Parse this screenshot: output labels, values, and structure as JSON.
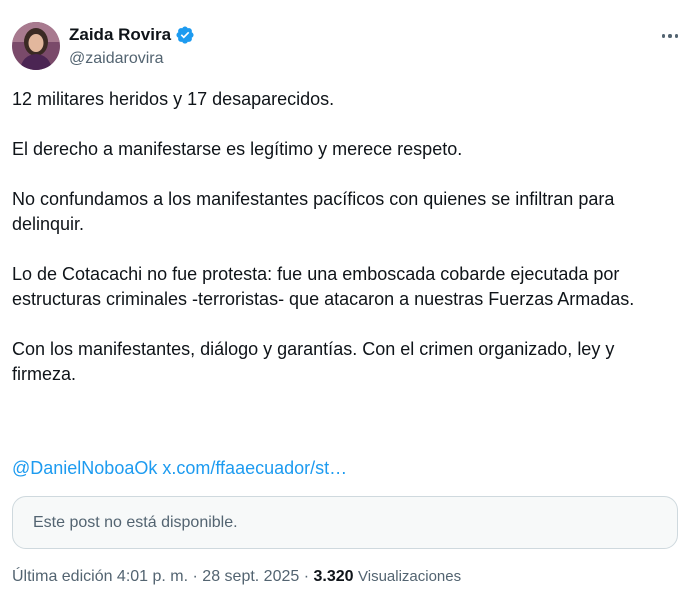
{
  "author": {
    "name": "Zaida Rovira",
    "handle": "@zaidarovira",
    "verified_icon": "verified-badge-icon",
    "verified_color": "#1d9bf0"
  },
  "tweet": {
    "paragraphs": [
      "12 militares heridos y 17 desaparecidos.",
      "El derecho a manifestarse es legítimo y merece respeto.",
      "No confundamos a los manifestantes pacíficos con quienes se infiltran para delinquir.",
      "Lo de Cotacachi no fue protesta: fue una emboscada cobarde ejecutada por estructuras criminales -terroristas- que atacaron a nuestras Fuerzas Armadas.",
      "Con los manifestantes, diálogo y garantías. Con el crimen organizado, ley y firmeza."
    ],
    "mention": "@DanielNoboaOk",
    "link": "x.com/ffaaecuador/st…"
  },
  "quoted": {
    "unavailable_text": "Este post no está disponible."
  },
  "meta": {
    "edited_label": "Última edición 4:01 p. m. · 28 sept. 2025 ·",
    "views_count": "3.320",
    "views_label": "Visualizaciones"
  },
  "colors": {
    "text": "#0f1419",
    "secondary": "#536471",
    "link": "#1d9bf0",
    "border": "#cfd9de"
  }
}
